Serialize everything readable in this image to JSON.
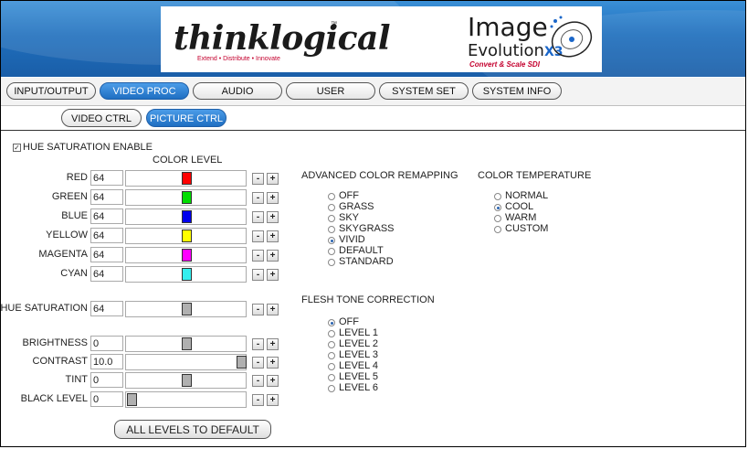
{
  "header": {
    "brand_name": "thinklogical",
    "brand_tm": "™",
    "brand_tagline": "Extend • Distribute • Innovate",
    "product_line1": "Image",
    "product_line2": "Evolution",
    "product_suffix": "X3",
    "product_subtitle": "Convert & Scale SDI"
  },
  "tabs": [
    {
      "label": "INPUT/OUTPUT"
    },
    {
      "label": "VIDEO PROC"
    },
    {
      "label": "AUDIO"
    },
    {
      "label": "USER"
    },
    {
      "label": "SYSTEM SET"
    },
    {
      "label": "SYSTEM INFO"
    }
  ],
  "active_tab": "VIDEO PROC",
  "subtabs": [
    {
      "label": "VIDEO CTRL"
    },
    {
      "label": "PICTURE CTRL"
    }
  ],
  "active_subtab": "PICTURE CTRL",
  "hue_saturation_enable": {
    "label": "HUE SATURATION ENABLE",
    "checked": true
  },
  "color_level_header": "COLOR LEVEL",
  "colors": [
    {
      "label": "RED",
      "value": "64",
      "color": "#ff0000",
      "level": 0.5
    },
    {
      "label": "GREEN",
      "value": "64",
      "color": "#00dd00",
      "level": 0.5
    },
    {
      "label": "BLUE",
      "value": "64",
      "color": "#0000ee",
      "level": 0.5
    },
    {
      "label": "YELLOW",
      "value": "64",
      "color": "#ffff00",
      "level": 0.5
    },
    {
      "label": "MAGENTA",
      "value": "64",
      "color": "#ff00ff",
      "level": 0.5
    },
    {
      "label": "CYAN",
      "value": "64",
      "color": "#33eeee",
      "level": 0.5
    }
  ],
  "hue_saturation": {
    "label": "HUE SATURATION",
    "value": "64",
    "color": "#b0b0b0",
    "level": 0.5
  },
  "adjustments": [
    {
      "label": "BRIGHTNESS",
      "value": "0",
      "color": "#b0b0b0",
      "level": 0.5
    },
    {
      "label": "CONTRAST",
      "value": "10.0",
      "color": "#b0b0b0",
      "level": 1.0
    },
    {
      "label": "TINT",
      "value": "0",
      "color": "#b0b0b0",
      "level": 0.5
    },
    {
      "label": "BLACK LEVEL",
      "value": "0",
      "color": "#b0b0b0",
      "level": 0.0
    }
  ],
  "buttons": {
    "minus": "-",
    "plus": "+",
    "all_default": "ALL LEVELS TO DEFAULT"
  },
  "advanced_color_remapping": {
    "title": "ADVANCED COLOR REMAPPING",
    "options": [
      "OFF",
      "GRASS",
      "SKY",
      "SKYGRASS",
      "VIVID",
      "DEFAULT",
      "STANDARD"
    ],
    "selected": "VIVID"
  },
  "color_temperature": {
    "title": "COLOR TEMPERATURE",
    "options": [
      "NORMAL",
      "COOL",
      "WARM",
      "CUSTOM"
    ],
    "selected": "COOL"
  },
  "flesh_tone_correction": {
    "title": "FLESH TONE CORRECTION",
    "options": [
      "OFF",
      "LEVEL 1",
      "LEVEL 2",
      "LEVEL 3",
      "LEVEL 4",
      "LEVEL 5",
      "LEVEL 6"
    ],
    "selected": "OFF"
  }
}
